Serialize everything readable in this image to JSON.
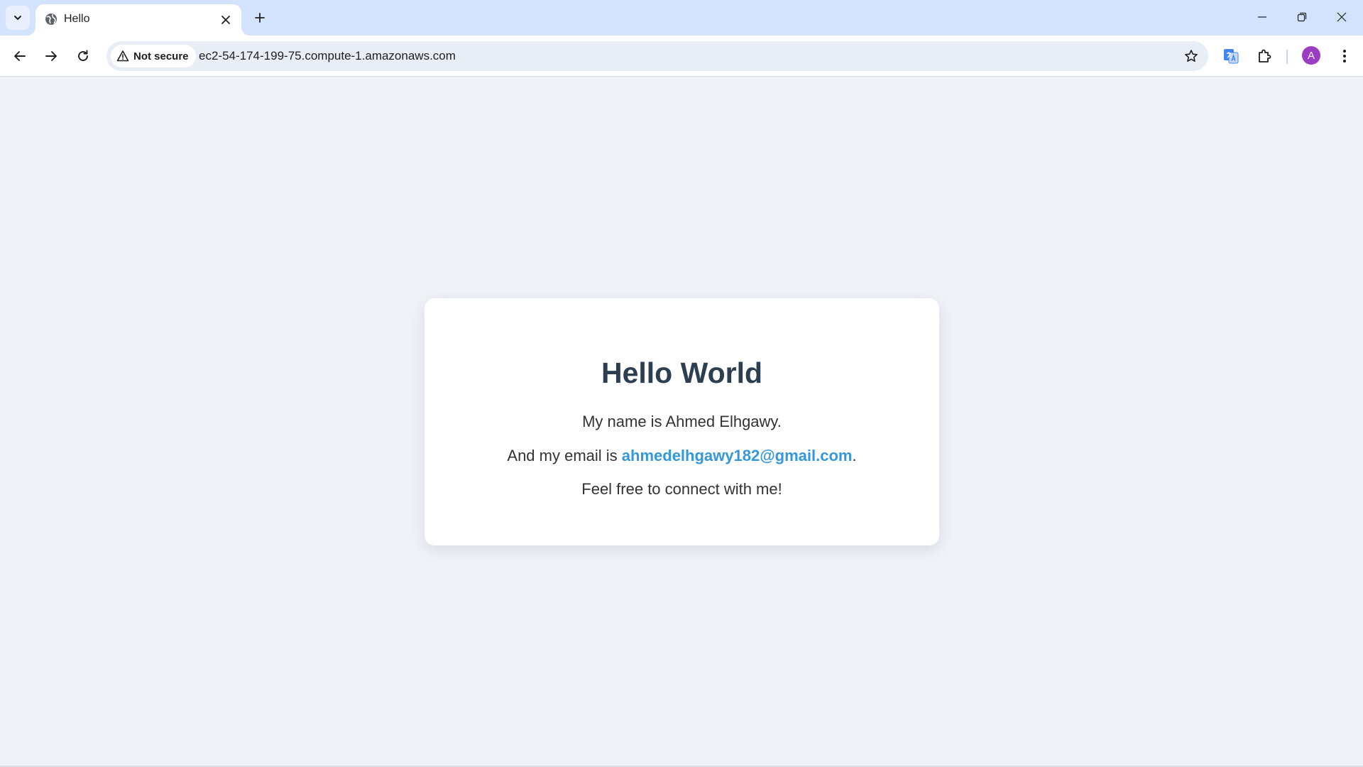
{
  "browser": {
    "tab": {
      "title": "Hello",
      "favicon": "globe-icon"
    },
    "address_bar": {
      "security_label": "Not secure",
      "url": "ec2-54-174-199-75.compute-1.amazonaws.com"
    },
    "profile_initial": "A",
    "colors": {
      "tabstrip": "#d3e3fd",
      "omnibox": "#e9eef6",
      "avatar": "#9c3cc4"
    },
    "icons": [
      "tab-search-icon",
      "close-icon",
      "plus-icon",
      "minimize-icon",
      "restore-icon",
      "window-close-icon",
      "back-arrow-icon",
      "forward-arrow-icon",
      "reload-icon",
      "warning-triangle-icon",
      "star-icon",
      "translate-icon",
      "puzzle-icon",
      "more-vert-icon"
    ]
  },
  "page": {
    "heading": "Hello World",
    "name_line": "My name is Ahmed Elhgawy.",
    "email_prefix": "And my email is ",
    "email": "ahmedelhgawy182@gmail.com",
    "email_suffix": ".",
    "connect_line": "Feel free to connect with me!",
    "colors": {
      "background": "#eff2f7",
      "card": "#ffffff",
      "heading": "#2c3e50",
      "link": "#3498db"
    }
  }
}
